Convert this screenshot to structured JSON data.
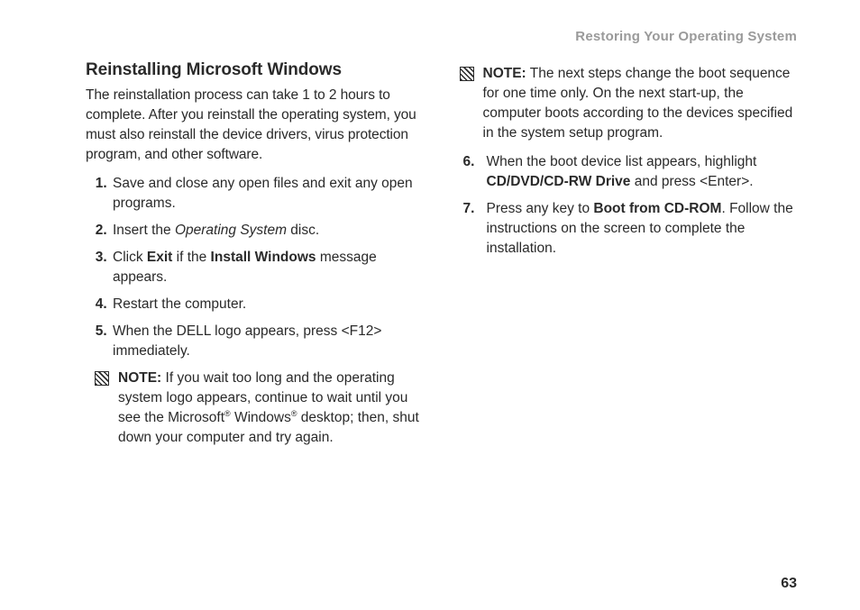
{
  "running_head": "Restoring Your Operating System",
  "heading": "Reinstalling Microsoft Windows",
  "intro": "The reinstallation process can take 1 to 2 hours to complete. After you reinstall the operating system, you must also reinstall the device drivers, virus protection program, and other software.",
  "steps": {
    "s1": "Save and close any open files and exit any open programs.",
    "s2a": "Insert the ",
    "s2b": "Operating System",
    "s2c": " disc.",
    "s3a": "Click ",
    "s3b": "Exit",
    "s3c": " if the ",
    "s3d": "Install Windows",
    "s3e": " message appears.",
    "s4": "Restart the computer.",
    "s5": "When the DELL logo appears, press <F12> immediately.",
    "s6a": "When the boot device list appears, highlight ",
    "s6b": "CD/DVD/CD-RW Drive",
    "s6c": " and press <Enter>.",
    "s7a": "Press any key to ",
    "s7b": "Boot from CD-ROM",
    "s7c": ". Follow the instructions on the screen to complete the installation."
  },
  "notes": {
    "label": "NOTE:",
    "n1a": " If you wait too long and the operating system logo appears, continue to wait until you see the Microsoft",
    "n1b": " Windows",
    "n1c": " desktop; then, shut down your computer and try again.",
    "n2": " The next steps change the boot sequence for one time only. On the next start-up, the computer boots according to the devices specified in the system setup program."
  },
  "reg": "®",
  "page_number": "63"
}
